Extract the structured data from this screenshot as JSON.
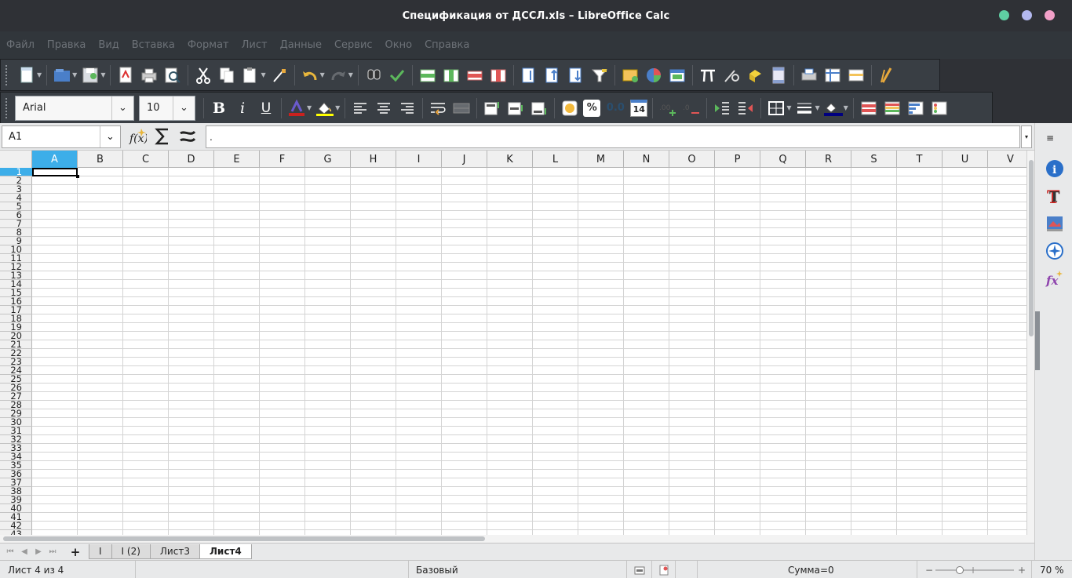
{
  "window": {
    "title": "Спецификация от ДССЛ.xls – LibreOffice Calc",
    "controls": [
      {
        "name": "minimize",
        "color": "#5fcfa3"
      },
      {
        "name": "maximize",
        "color": "#b3b8ef"
      },
      {
        "name": "close",
        "color": "#f2a0c8"
      }
    ]
  },
  "menu": [
    "Файл",
    "Правка",
    "Вид",
    "Вставка",
    "Формат",
    "Лист",
    "Данные",
    "Сервис",
    "Окно",
    "Справка"
  ],
  "formatting": {
    "font_name": "Arial",
    "font_size": "10",
    "bold_label": "B",
    "italic_label": "i",
    "underline_label": "U",
    "number_format_label": "0.0",
    "date_label": "14",
    "percent_label": "%"
  },
  "formula_bar": {
    "cell_reference": "A1",
    "formula": "."
  },
  "columns": [
    "A",
    "B",
    "C",
    "D",
    "E",
    "F",
    "G",
    "H",
    "I",
    "J",
    "K",
    "L",
    "M",
    "N",
    "O",
    "P",
    "Q",
    "R",
    "S",
    "T",
    "U",
    "V"
  ],
  "rows": [
    "1",
    "2",
    "3",
    "4",
    "5",
    "6",
    "7",
    "8",
    "9",
    "10",
    "11",
    "12",
    "13",
    "14",
    "15",
    "16",
    "17",
    "18",
    "19",
    "20",
    "21",
    "22",
    "23",
    "24",
    "25",
    "26",
    "27",
    "28",
    "29",
    "30",
    "31",
    "32",
    "33",
    "34",
    "35",
    "36",
    "37",
    "38",
    "39",
    "40",
    "41",
    "42",
    "43"
  ],
  "active_cell": {
    "column": "A",
    "row": "1"
  },
  "sheets": {
    "add_label": "+",
    "tabs": [
      "I",
      "I (2)",
      "Лист3",
      "Лист4"
    ],
    "active": "Лист4"
  },
  "statusbar": {
    "sheet_info": "Лист 4 из 4",
    "page_style": "Базовый",
    "sum": "Сумма=0",
    "zoom_minus": "−",
    "zoom_plus": "+",
    "zoom_percent": "70 %"
  },
  "colors": {
    "accent": "#3daee9",
    "titlebar": "#2f3136",
    "toolbar": "#393e44"
  }
}
